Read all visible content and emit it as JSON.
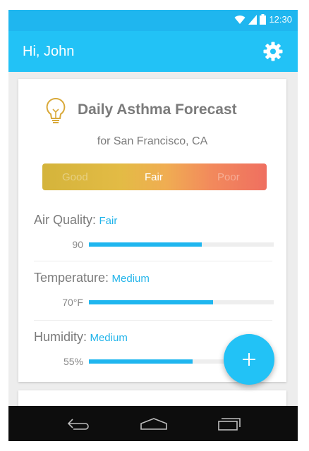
{
  "status_bar": {
    "time": "12:30"
  },
  "app_bar": {
    "greeting": "Hi, John"
  },
  "forecast": {
    "title": "Daily Asthma Forecast",
    "location": "for San Francisco, CA",
    "scale": {
      "good": "Good",
      "current": "Fair",
      "poor": "Poor"
    }
  },
  "metrics": [
    {
      "label": "Air Quality:",
      "level": "Fair",
      "value": "90",
      "fill": 0.61
    },
    {
      "label": "Temperature:",
      "level": "Medium",
      "value": "70°F",
      "fill": 0.67
    },
    {
      "label": "Humidity:",
      "level": "Medium",
      "value": "55%",
      "fill": 0.56
    }
  ],
  "colors": {
    "primary": "#22c2f6",
    "status_bar": "#1fb6ef",
    "accent_text": "#22b4ea"
  },
  "icons": [
    "wifi-icon",
    "signal-icon",
    "battery-icon",
    "gear-icon",
    "lightbulb-icon",
    "plus-icon",
    "back-icon",
    "home-icon",
    "recents-icon"
  ]
}
